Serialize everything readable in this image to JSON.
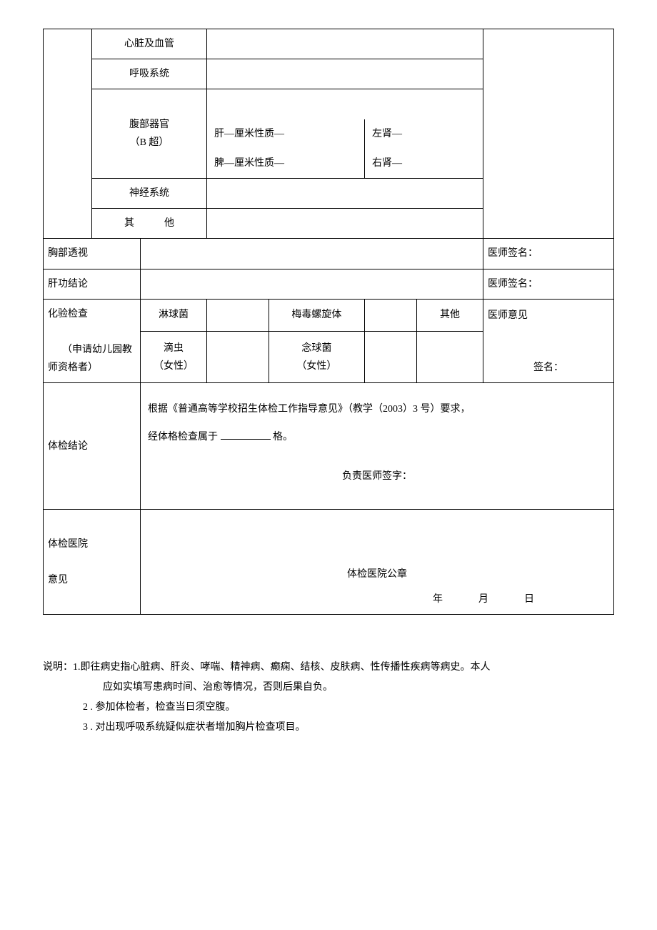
{
  "rows": {
    "heart": "心脏及血管",
    "resp": "呼吸系统",
    "abdomen": "腹部器官",
    "bscan": "（B 超）",
    "liver_line": "肝—厘米性质—",
    "left_kidney": "左肾—",
    "spleen_line": "脾—厘米性质—",
    "right_kidney": "右肾—",
    "nervous": "神经系统",
    "other": "其　　　他"
  },
  "chest": {
    "label": "胸部透视",
    "sign_label": "医师签名："
  },
  "liverfn": {
    "label": "肝功结论",
    "sign_label": "医师签名："
  },
  "lab": {
    "label": "化验检查",
    "sub": "（申请幼儿园教师资格者）",
    "gono": "淋球菌",
    "syph": "梅毒螺旋体",
    "other": "其他",
    "doc_opinion": "医师意见",
    "trich": "滴虫",
    "trich_sub": "（女性）",
    "candida": "念球菌",
    "candida_sub": "（女性）",
    "sign": "签名："
  },
  "conclusion": {
    "label": "体检结论",
    "line1": "根据《普通高等学校招生体检工作指导意见》（教学（2003）3 号）要求，",
    "line2a": "经体格检查属于 ",
    "line2b": " 格。",
    "doc_sign": "负责医师签字："
  },
  "hospital": {
    "label_l1": "体检医院",
    "label_l2": "意见",
    "seal": "体检医院公章",
    "date": "年　　　月　　　日"
  },
  "notes": {
    "prefix": "说明：",
    "n1_num": "1.",
    "n1a": "即往病史指心脏病、肝炎、哮喘、精神病、癫痫、结核、皮肤病、性传播性疾病等病史。本人",
    "n1b": "应如实填写患病时间、治愈等情况，否则后果自负。",
    "n2_num": "2 .",
    "n2": "参加体检者，检查当日须空腹。",
    "n3_num": "3 .",
    "n3": "对出现呼吸系统疑似症状者增加胸片检查项目。"
  }
}
